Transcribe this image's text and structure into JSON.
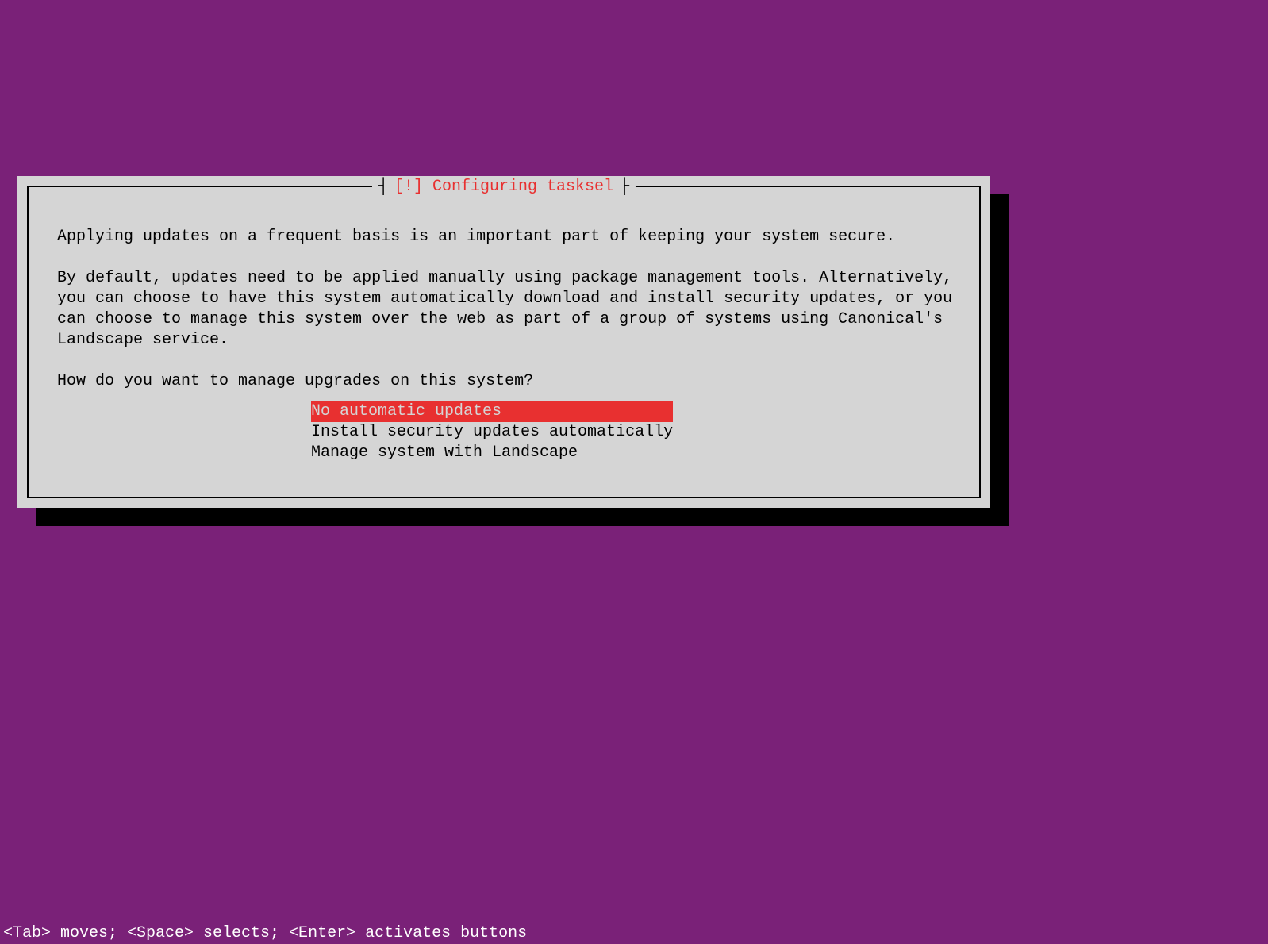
{
  "dialog": {
    "title": "[!] Configuring tasksel",
    "paragraph1": "Applying updates on a frequent basis is an important part of keeping your system secure.",
    "paragraph2": "By default, updates need to be applied manually using package management tools. Alternatively, you can choose to have this system automatically download and install security updates, or you can choose to manage this system over the web as part of a group of systems using Canonical's Landscape service.",
    "question": "How do you want to manage upgrades on this system?",
    "options": [
      {
        "label": "No automatic updates                  ",
        "selected": true
      },
      {
        "label": "Install security updates automatically",
        "selected": false
      },
      {
        "label": "Manage system with Landscape          ",
        "selected": false
      }
    ]
  },
  "footer": {
    "text": "<Tab> moves; <Space> selects; <Enter> activates buttons"
  },
  "colors": {
    "background": "#7a2178",
    "dialog_bg": "#d5d5d5",
    "accent_red": "#e83030",
    "text": "#000000",
    "footer_text": "#ffffff"
  }
}
